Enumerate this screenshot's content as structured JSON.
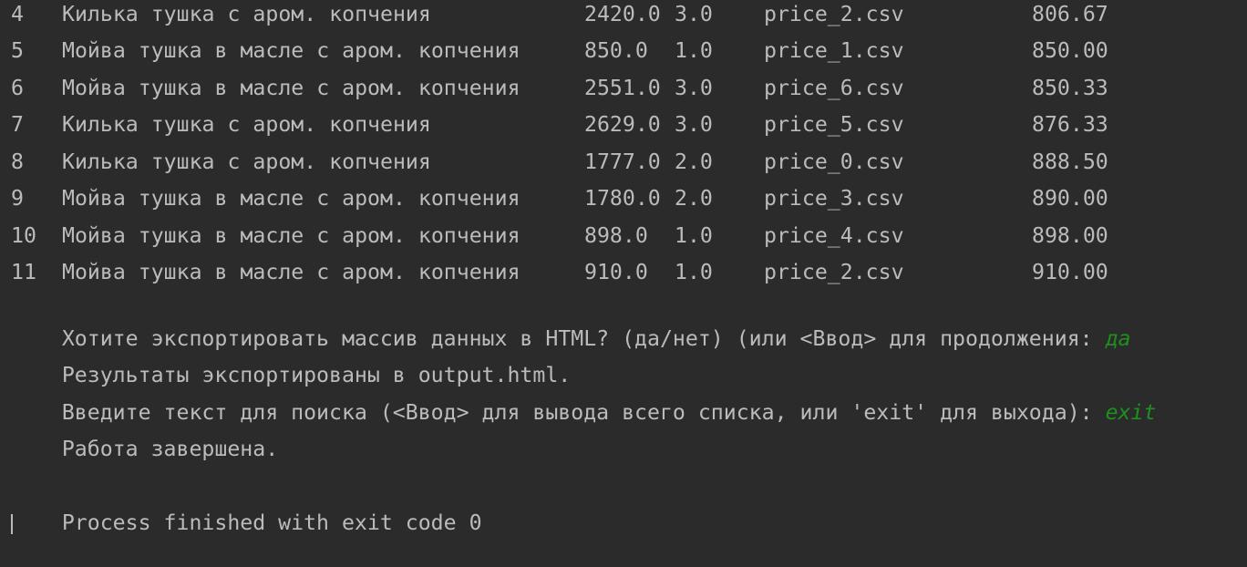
{
  "table_rows": [
    {
      "idx": "4",
      "name": "Килька тушка с аром. копчения",
      "price": "2420.0",
      "qty": "3.0",
      "file": "price_2.csv",
      "unit_price": "806.67"
    },
    {
      "idx": "5",
      "name": "Мойва тушка в масле с аром. копчения",
      "price": "850.0",
      "qty": "1.0",
      "file": "price_1.csv",
      "unit_price": "850.00"
    },
    {
      "idx": "6",
      "name": "Мойва тушка в масле с аром. копчения",
      "price": "2551.0",
      "qty": "3.0",
      "file": "price_6.csv",
      "unit_price": "850.33"
    },
    {
      "idx": "7",
      "name": "Килька тушка с аром. копчения",
      "price": "2629.0",
      "qty": "3.0",
      "file": "price_5.csv",
      "unit_price": "876.33"
    },
    {
      "idx": "8",
      "name": "Килька тушка с аром. копчения",
      "price": "1777.0",
      "qty": "2.0",
      "file": "price_0.csv",
      "unit_price": "888.50"
    },
    {
      "idx": "9",
      "name": "Мойва тушка в масле с аром. копчения",
      "price": "1780.0",
      "qty": "2.0",
      "file": "price_3.csv",
      "unit_price": "890.00"
    },
    {
      "idx": "10",
      "name": "Мойва тушка в масле с аром. копчения",
      "price": "898.0",
      "qty": "1.0",
      "file": "price_4.csv",
      "unit_price": "898.00"
    },
    {
      "idx": "11",
      "name": "Мойва тушка в масле с аром. копчения",
      "price": "910.0",
      "qty": "1.0",
      "file": "price_2.csv",
      "unit_price": "910.00"
    }
  ],
  "export_prompt": {
    "text": "Хотите экспортировать массив данных в HTML? (да/нет) (или <Ввод> для продолжения: ",
    "input": "да"
  },
  "export_result": "Результаты экспортированы в output.html.",
  "search_prompt": {
    "text": "Введите текст для поиска (<Ввод> для вывода всего списка, или 'exit' для выхода): ",
    "input": "exit"
  },
  "work_done": "Работа завершена.",
  "process_finished": "Process finished with exit code 0",
  "colors": {
    "background": "#2b2b2b",
    "text": "#bbbbbb",
    "user_input": "#1e8f1e"
  }
}
